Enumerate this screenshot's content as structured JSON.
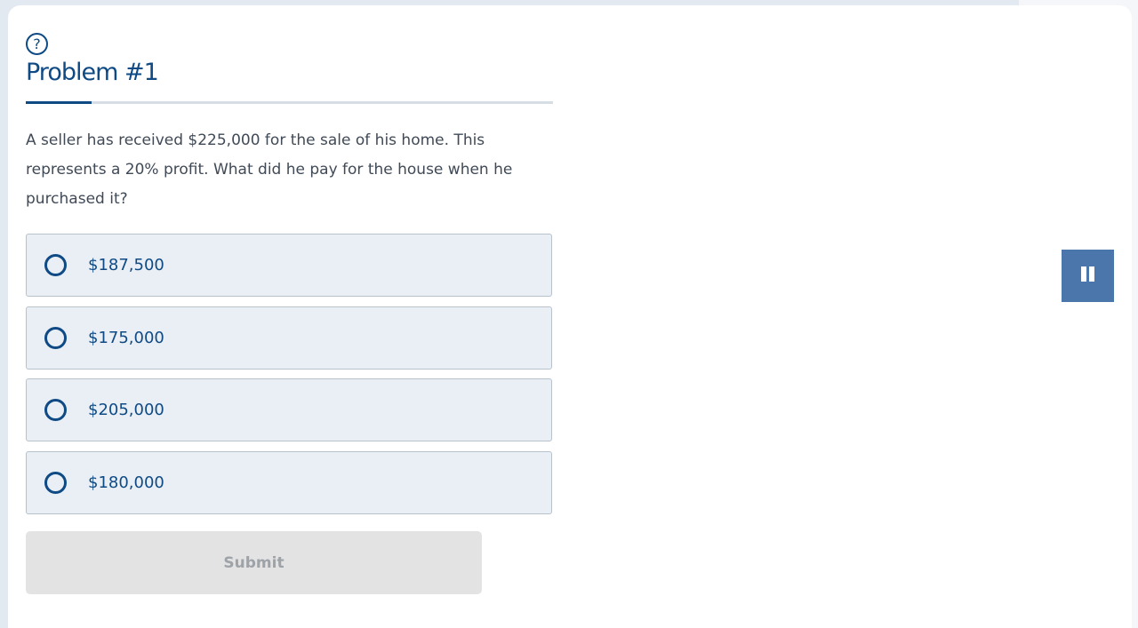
{
  "header": {
    "help_icon_glyph": "?",
    "title": "Problem #1"
  },
  "progress": {
    "fraction": 0.125
  },
  "question": {
    "text": "A seller has received $225,000 for the sale of his home. This represents a 20% profit. What did he pay for the house when he purchased it?"
  },
  "options": [
    {
      "label": "$187,500"
    },
    {
      "label": "$175,000"
    },
    {
      "label": "$205,000"
    },
    {
      "label": "$180,000"
    }
  ],
  "submit": {
    "label": "Submit",
    "enabled": false
  },
  "pause": {
    "icon": "pause-icon"
  },
  "colors": {
    "accent": "#0f4a85",
    "option_bg": "#e9eff5",
    "pause_bg": "#4a76ab",
    "submit_disabled_bg": "#e3e3e3"
  }
}
